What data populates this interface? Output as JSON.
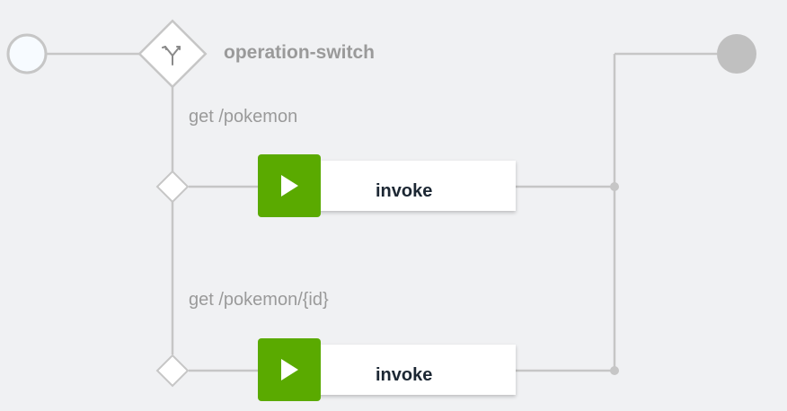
{
  "flow": {
    "start_event": {
      "icon": "start-circle-icon"
    },
    "end_event": {
      "icon": "end-circle-icon"
    },
    "switch": {
      "label": "operation-switch",
      "icon": "split-arrows-icon"
    },
    "cases": [
      {
        "label": "get /pokemon",
        "node": {
          "label": "invoke",
          "icon": "play-icon"
        }
      },
      {
        "label": "get /pokemon/{id}",
        "node": {
          "label": "invoke",
          "icon": "play-icon"
        }
      }
    ]
  },
  "colors": {
    "background": "#f0f1f3",
    "connector": "#c6c6c6",
    "end_fill": "#c0c0c0",
    "start_fill": "#f7fbff",
    "invoke_accent": "#5aaa00",
    "label_muted": "#9a9a9a",
    "node_text": "#1c2733"
  }
}
